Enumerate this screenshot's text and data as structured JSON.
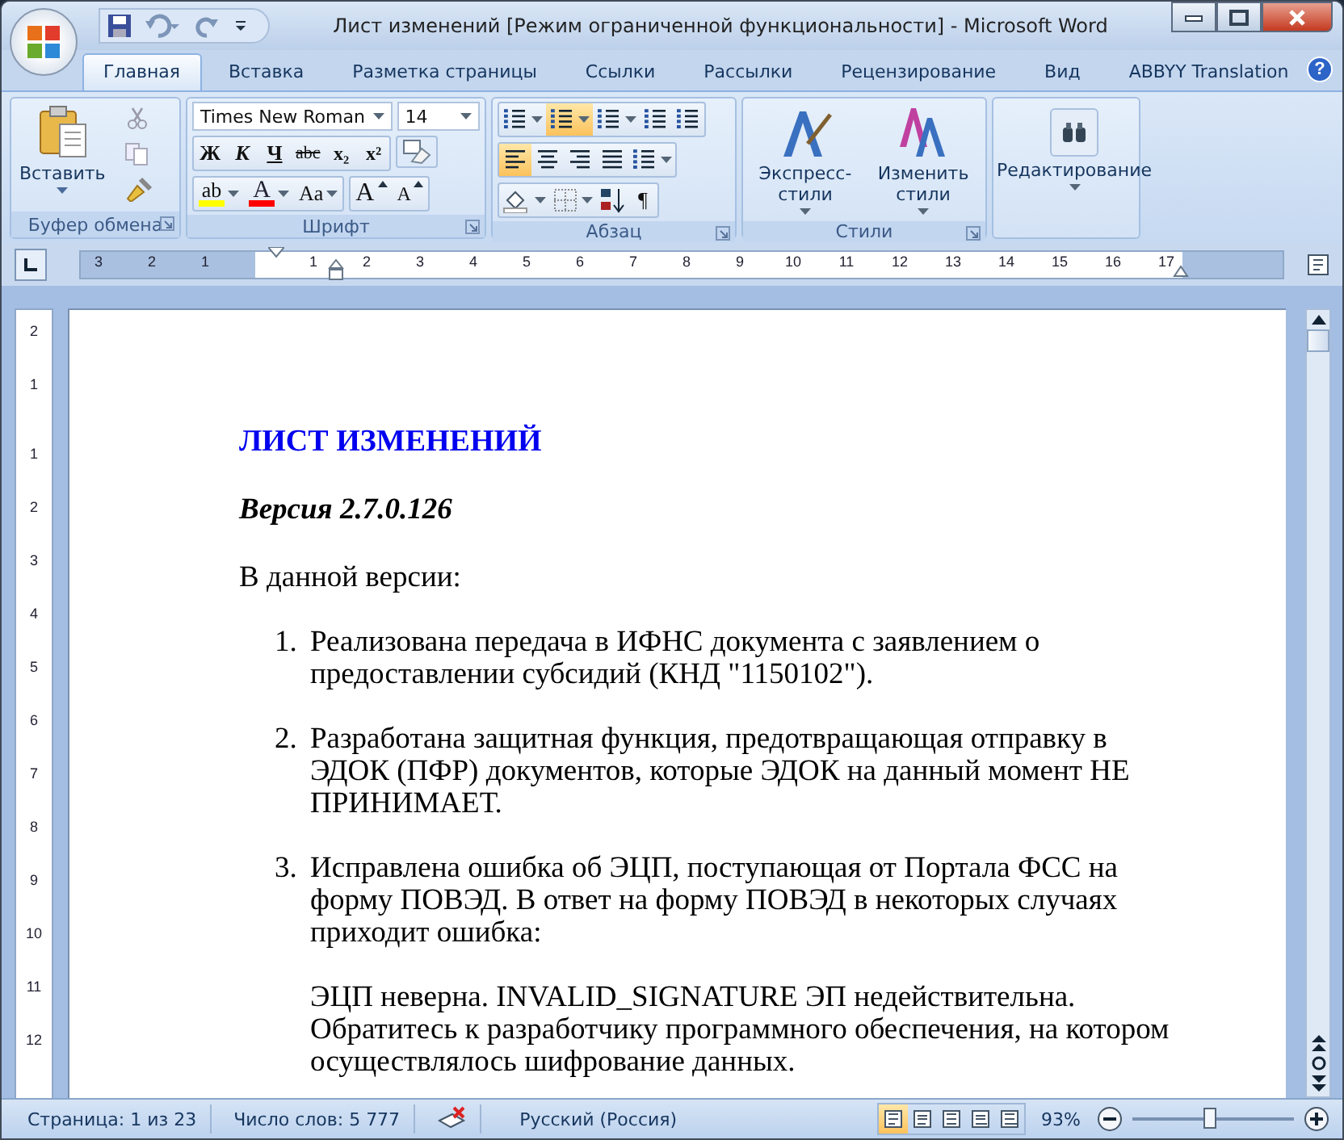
{
  "window": {
    "title": "Лист изменений [Режим ограниченной функциональности]  -  Microsoft Word"
  },
  "tabs": [
    {
      "label": "Главная",
      "selected": true
    },
    {
      "label": "Вставка",
      "selected": false
    },
    {
      "label": "Разметка страницы",
      "selected": false
    },
    {
      "label": "Ссылки",
      "selected": false
    },
    {
      "label": "Рассылки",
      "selected": false
    },
    {
      "label": "Рецензирование",
      "selected": false
    },
    {
      "label": "Вид",
      "selected": false
    },
    {
      "label": "ABBYY Translation",
      "selected": false
    }
  ],
  "help": {
    "label": "?"
  },
  "ribbon": {
    "clipboard": {
      "label": "Буфер обмена",
      "paste": "Вставить"
    },
    "font": {
      "label": "Шрифт",
      "font_name": "Times New Roman",
      "font_size": "14",
      "format_buttons": [
        {
          "kind": "bold",
          "label": "Ж"
        },
        {
          "kind": "italic",
          "label": "К"
        },
        {
          "kind": "underline",
          "label": "Ч"
        },
        {
          "kind": "strike",
          "label": "abc"
        },
        {
          "kind": "subscript",
          "label": "x₂"
        },
        {
          "kind": "superscript",
          "label": "x²"
        }
      ],
      "color_buttons": [
        {
          "kind": "highlight",
          "label": "ab",
          "color": "#ffff00"
        },
        {
          "kind": "font-color",
          "label": "A",
          "color": "#ff0000"
        }
      ],
      "size_buttons": [
        {
          "kind": "case",
          "label": "Aa"
        },
        {
          "kind": "grow",
          "label": "A"
        },
        {
          "kind": "shrink",
          "label": "A"
        }
      ]
    },
    "paragraph": {
      "label": "Абзац",
      "row_1": [
        {
          "kind": "bullets",
          "selected": false
        },
        {
          "kind": "numbering",
          "selected": true
        },
        {
          "kind": "multilevel",
          "selected": false
        },
        {
          "kind": "outdent",
          "selected": false
        },
        {
          "kind": "indent",
          "selected": false
        }
      ],
      "row_2": [
        {
          "kind": "align-left",
          "selected": true
        },
        {
          "kind": "align-center",
          "selected": false
        },
        {
          "kind": "align-right",
          "selected": false
        },
        {
          "kind": "justify",
          "selected": false
        },
        {
          "kind": "line-spacing",
          "selected": false
        }
      ],
      "row_3": [
        {
          "kind": "shading",
          "selected": false
        },
        {
          "kind": "borders",
          "selected": false
        },
        {
          "kind": "sort",
          "selected": false
        },
        {
          "kind": "pilcrow",
          "label": "¶",
          "selected": false
        }
      ]
    },
    "styles": {
      "label": "Стили",
      "buttons": [
        {
          "kind": "quick-styles",
          "label": "Экспресс-стили"
        },
        {
          "kind": "change-styles",
          "label": "Изменить стили"
        }
      ]
    },
    "editing": {
      "label": "Редактирование"
    }
  },
  "ruler": {
    "labels": [
      "3",
      "2",
      "1",
      "1",
      "2",
      "3",
      "4",
      "5",
      "6",
      "7",
      "8",
      "9",
      "10",
      "11",
      "12",
      "13",
      "14",
      "15",
      "16",
      "17"
    ]
  },
  "vertical_ruler": {
    "labels": [
      "2",
      "1",
      "1",
      "2",
      "3",
      "4",
      "5",
      "6",
      "7",
      "8",
      "9",
      "10",
      "11",
      "12"
    ]
  },
  "document": {
    "heading": "ЛИСТ ИЗМЕНЕНИЙ",
    "version": "Версия 2.7.0.126",
    "intro": "В данной версии:",
    "items": [
      {
        "number": "1.",
        "text": "Реализована передача в ИФНС  документа с заявлением о предоставлении субсидий (КНД \"1150102\")."
      },
      {
        "number": "2.",
        "text": "Разработана защитная функция, предотвращающая отправку в ЭДОК (ПФР) документов, которые ЭДОК на данный момент НЕ ПРИНИМАЕТ."
      },
      {
        "number": "3.",
        "text": "Исправлена ошибка об ЭЦП, поступающая от Портала ФСС на форму ПОВЭД. В ответ на форму ПОВЭД в некоторых случаях приходит ошибка:",
        "note": "ЭЦП неверна. INVALID_SIGNATURE  ЭП недействительна. Обратитесь к разработчику программного обеспечения, на котором осуществлялось шифрование данных."
      }
    ]
  },
  "status_bar": {
    "page": "Страница: 1 из 23",
    "words": "Число слов: 5 777",
    "language": "Русский (Россия)",
    "views": [
      {
        "selected": true
      },
      {
        "selected": false
      },
      {
        "selected": false
      },
      {
        "selected": false
      },
      {
        "selected": false
      }
    ],
    "zoom": "93%",
    "zoom_slider": {
      "level": 0.48
    }
  }
}
